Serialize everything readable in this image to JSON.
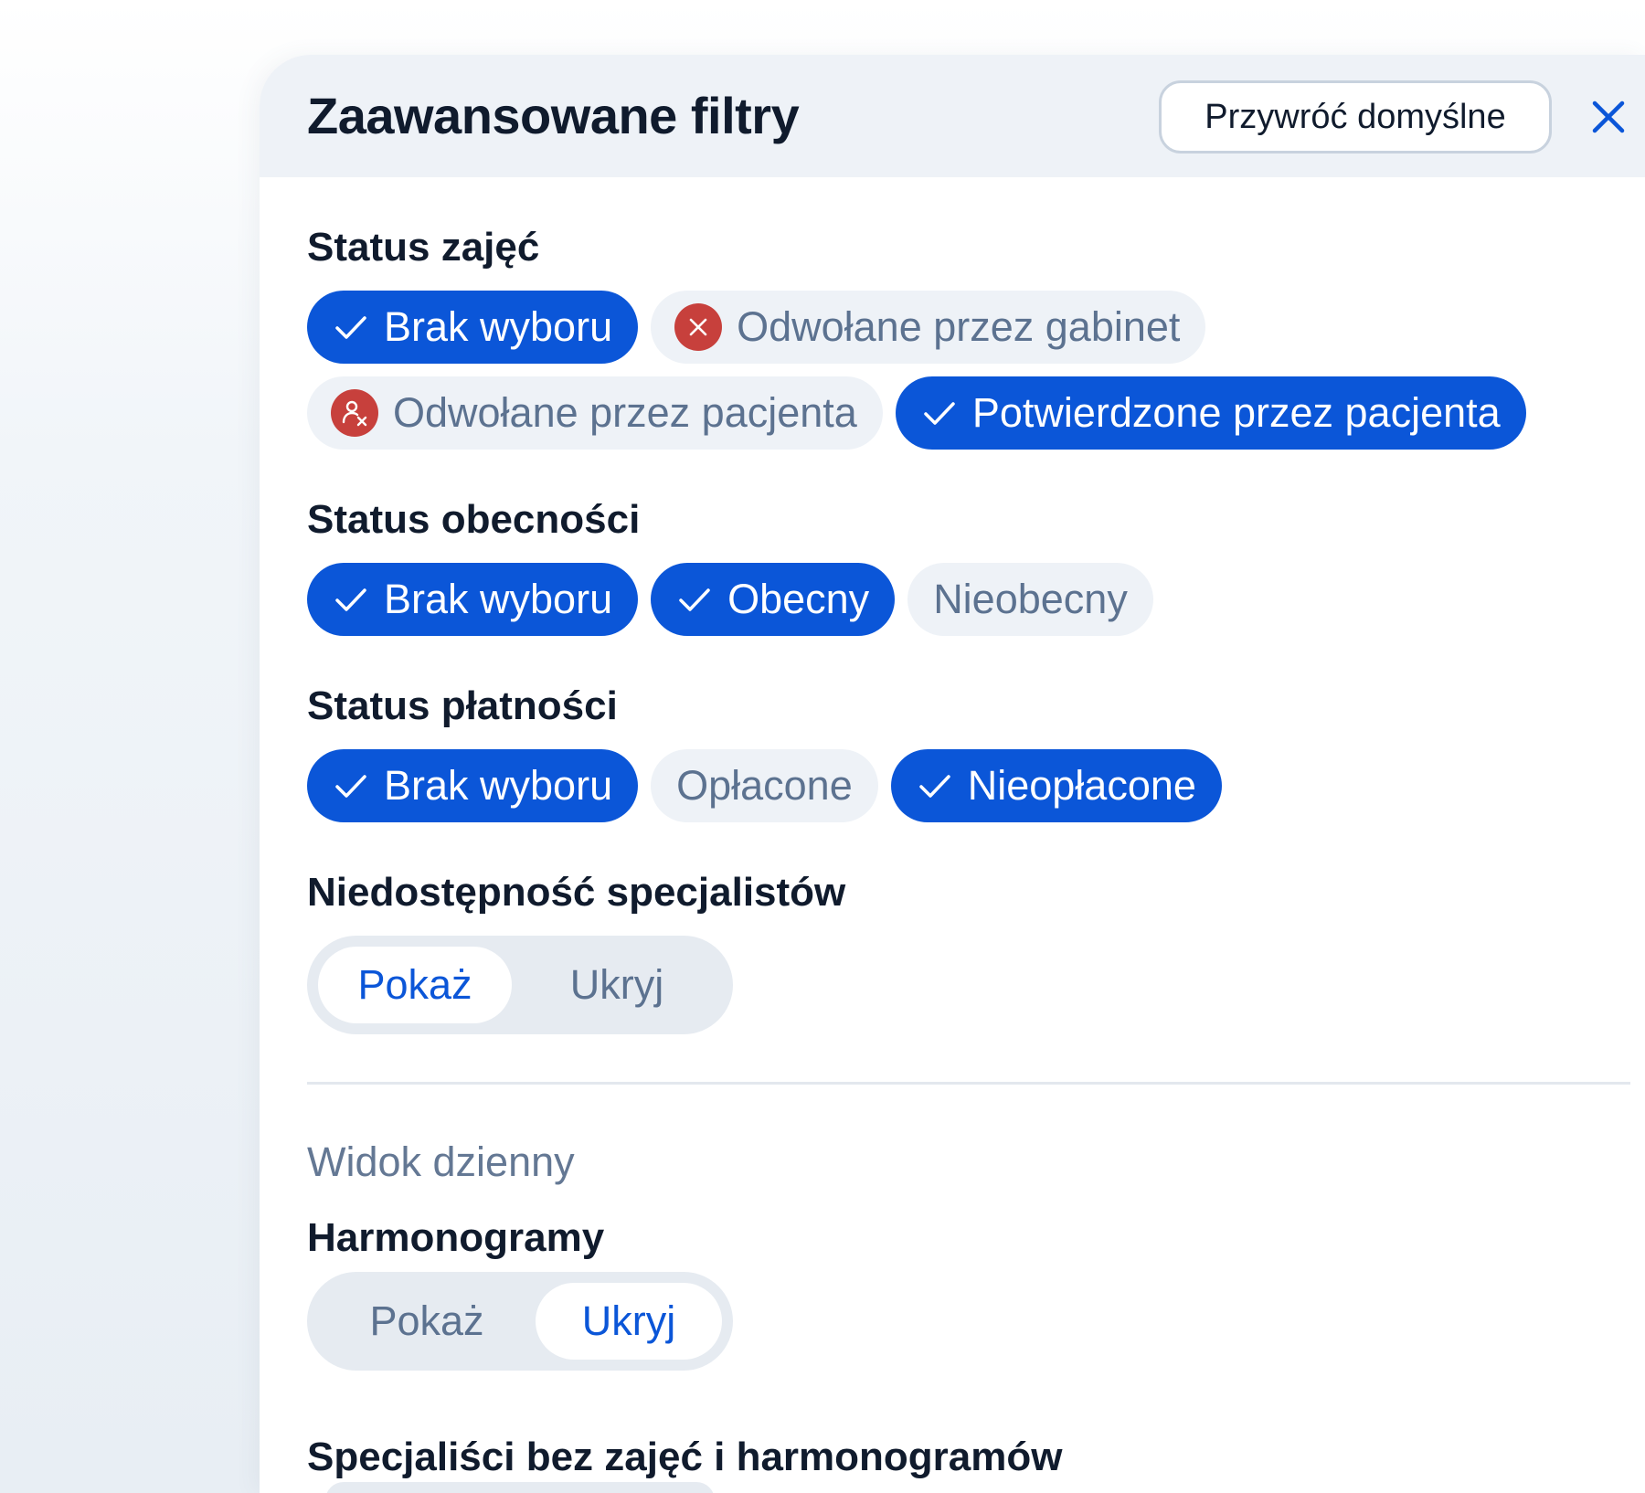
{
  "header": {
    "title": "Zaawansowane filtry",
    "reset_label": "Przywróć domyślne"
  },
  "sections": {
    "class_status": {
      "title": "Status zajęć",
      "options": [
        {
          "label": "Brak wyboru",
          "selected": true
        },
        {
          "label": "Odwołane przez gabinet",
          "selected": false,
          "icon": "close-circle-icon"
        },
        {
          "label": "Odwołane przez pacjenta",
          "selected": false,
          "icon": "person-cancel-icon"
        },
        {
          "label": "Potwierdzone przez pacjenta",
          "selected": true
        }
      ]
    },
    "attendance_status": {
      "title": "Status obecności",
      "options": [
        {
          "label": "Brak wyboru",
          "selected": true
        },
        {
          "label": "Obecny",
          "selected": true
        },
        {
          "label": "Nieobecny",
          "selected": false
        }
      ]
    },
    "payment_status": {
      "title": "Status płatności",
      "options": [
        {
          "label": "Brak wyboru",
          "selected": true
        },
        {
          "label": "Opłacone",
          "selected": false
        },
        {
          "label": "Nieopłacone",
          "selected": true
        }
      ]
    },
    "specialist_unavailability": {
      "title": "Niedostępność specjalistów",
      "show_label": "Pokaż",
      "hide_label": "Ukryj",
      "active": "show"
    },
    "day_view": {
      "heading": "Widok dzienny"
    },
    "schedules": {
      "title": "Harmonogramy",
      "show_label": "Pokaż",
      "hide_label": "Ukryj",
      "active": "hide"
    },
    "specialists_without": {
      "title": "Specjaliści bez zajęć i harmonogramów"
    }
  },
  "colors": {
    "accent": "#0b56d8",
    "danger": "#c7403c",
    "text_dark": "#101b2d",
    "text_muted": "#5c7290"
  }
}
